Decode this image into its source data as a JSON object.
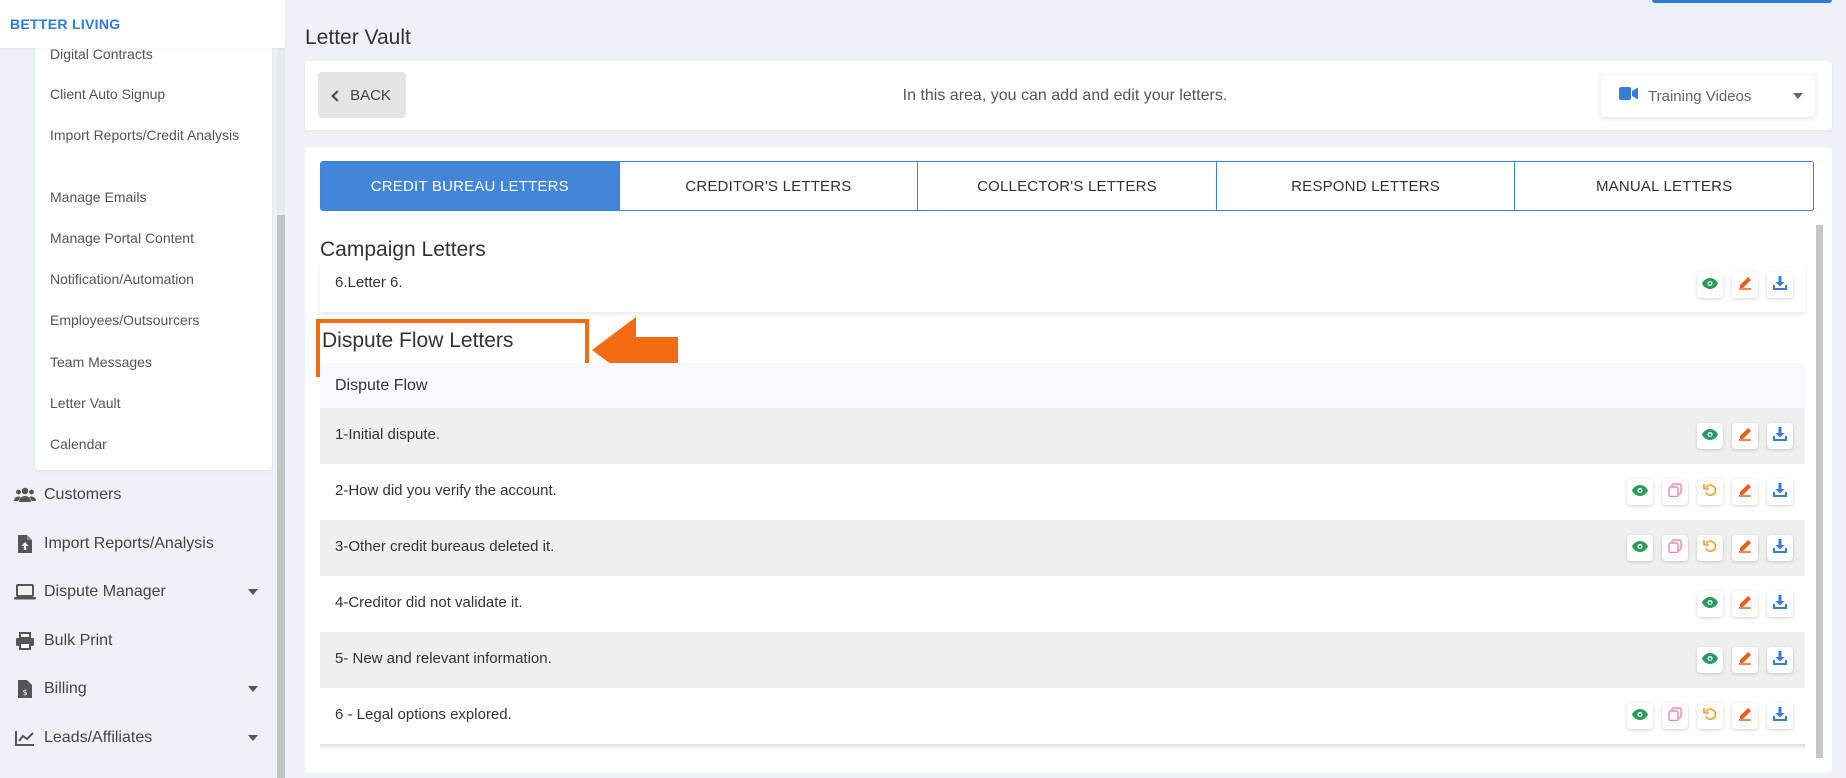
{
  "sidebar": {
    "brand": "BETTER LIVING",
    "submenu": [
      "Digital Contracts",
      "Client Auto Signup",
      "Import Reports/Credit Analysis",
      "Manage Emails",
      "Manage Portal Content",
      "Notification/Automation",
      "Employees/Outsourcers",
      "Team Messages",
      "Letter Vault",
      "Calendar"
    ],
    "nav": [
      {
        "label": "Customers",
        "icon": "users-icon"
      },
      {
        "label": "Import Reports/Analysis",
        "icon": "file-upload-icon"
      },
      {
        "label": "Dispute Manager",
        "icon": "laptop-icon"
      },
      {
        "label": "Bulk Print",
        "icon": "printer-icon"
      },
      {
        "label": "Billing",
        "icon": "invoice-icon"
      },
      {
        "label": "Leads/Affiliates",
        "icon": "chart-line-icon"
      }
    ]
  },
  "page": {
    "title": "Letter Vault",
    "back_label": "BACK",
    "header_text": "In this area, you can add and edit your letters.",
    "training_label": "Training Videos"
  },
  "tabs": [
    {
      "label": "CREDIT BUREAU LETTERS",
      "active": true
    },
    {
      "label": "CREDITOR'S LETTERS",
      "active": false
    },
    {
      "label": "COLLECTOR'S LETTERS",
      "active": false
    },
    {
      "label": "RESPOND LETTERS",
      "active": false
    },
    {
      "label": "MANUAL LETTERS",
      "active": false
    }
  ],
  "campaign": {
    "title": "Campaign Letters",
    "rows": [
      {
        "label": "6.Letter 6.",
        "actions": [
          "view",
          "edit",
          "download"
        ]
      }
    ]
  },
  "dispute": {
    "title": "Dispute Flow Letters",
    "group_label": "Dispute Flow",
    "rows": [
      {
        "label": "1-Initial dispute.",
        "actions": [
          "view",
          "edit",
          "download"
        ]
      },
      {
        "label": "2-How did you verify the account.",
        "actions": [
          "view",
          "copy",
          "reset",
          "edit",
          "download"
        ]
      },
      {
        "label": "3-Other credit bureaus deleted it.",
        "actions": [
          "view",
          "copy",
          "reset",
          "edit",
          "download"
        ]
      },
      {
        "label": "4-Creditor did not validate it.",
        "actions": [
          "view",
          "edit",
          "download"
        ]
      },
      {
        "label": "5- New and relevant information.",
        "actions": [
          "view",
          "edit",
          "download"
        ]
      },
      {
        "label": "6 - Legal options explored.",
        "actions": [
          "view",
          "copy",
          "reset",
          "edit",
          "download"
        ]
      }
    ]
  },
  "colors": {
    "accent": "#4285d9",
    "highlight": "#f36c11",
    "view": "#2a9d5c",
    "edit": "#e8621a",
    "download": "#3a7bd5",
    "copy": "#e88aa8",
    "reset": "#f0a020"
  }
}
